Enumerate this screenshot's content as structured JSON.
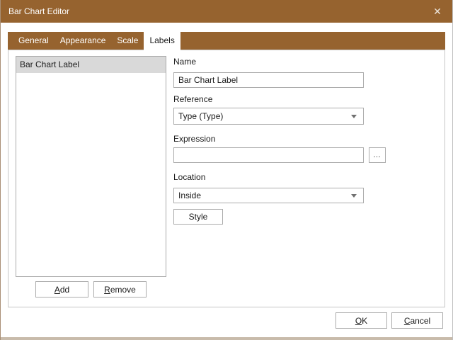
{
  "window": {
    "title": "Bar Chart Editor",
    "close_glyph": "✕"
  },
  "tabs": [
    {
      "label": "General",
      "active": false
    },
    {
      "label": "Appearance",
      "active": false
    },
    {
      "label": "Scale",
      "active": false
    },
    {
      "label": "Labels",
      "active": true
    }
  ],
  "labels_tab": {
    "list": {
      "items": [
        "Bar Chart Label"
      ],
      "selected_index": 0
    },
    "buttons": {
      "add": {
        "mnemonic": "A",
        "rest": "dd"
      },
      "remove": {
        "mnemonic": "R",
        "rest": "emove"
      }
    },
    "fields": {
      "name": {
        "label": "Name",
        "value": "Bar Chart Label"
      },
      "reference": {
        "label": "Reference",
        "value": "Type (Type)"
      },
      "expression": {
        "label": "Expression",
        "value": "",
        "browse_glyph": "…"
      },
      "location": {
        "label": "Location",
        "value": "Inside"
      },
      "style_button_label": "Style"
    }
  },
  "footer": {
    "ok": {
      "mnemonic": "O",
      "rest": "K"
    },
    "cancel": {
      "mnemonic": "C",
      "rest": "ancel"
    }
  },
  "colors": {
    "titlebar": "#96632F",
    "tabstrip": "#96632F",
    "selected_item_bg": "#d9d9d9",
    "control_border": "#ababab",
    "panel_border": "#c6c6c6"
  }
}
